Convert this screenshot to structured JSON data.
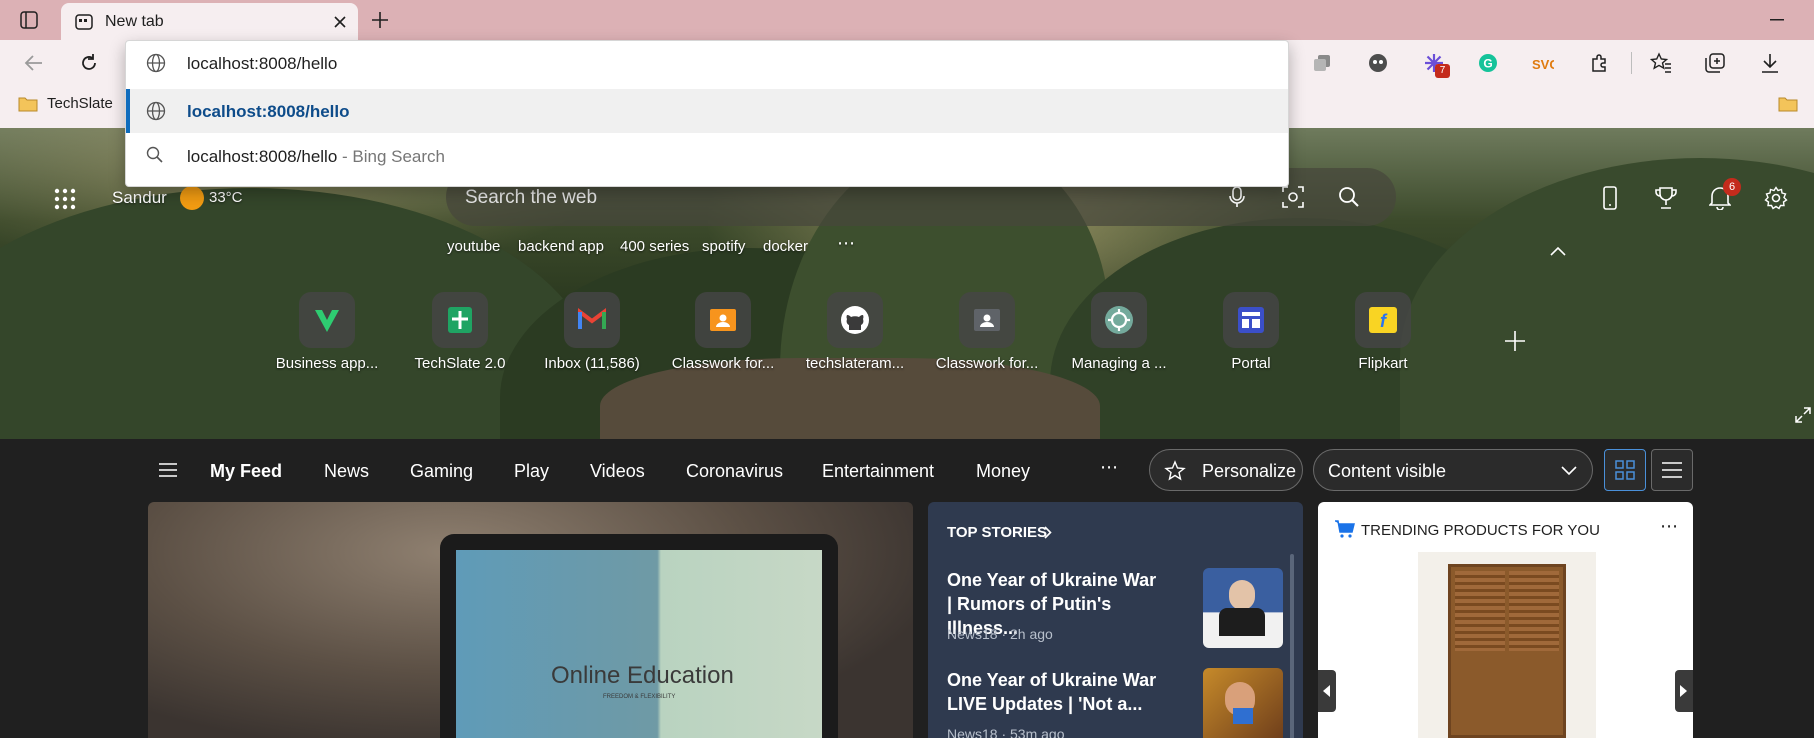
{
  "browser": {
    "tab_title": "New tab",
    "address_value": "localhost:8008/hello",
    "extension_badge": "7",
    "bookmarks": [
      "TechSlate"
    ]
  },
  "omnibox": {
    "suggestions": [
      {
        "text": "localhost:8008/hello",
        "suffix": ""
      },
      {
        "text": "localhost:8008/hello",
        "suffix": " - Bing Search"
      }
    ]
  },
  "weather": {
    "location": "Sandur",
    "temp": "33°C"
  },
  "search": {
    "placeholder": "Search the web"
  },
  "quick_links": [
    "youtube",
    "backend app",
    "400 series",
    "spotify",
    "docker"
  ],
  "more_symbol": "⋯",
  "notifications_count": "6",
  "tiles": [
    {
      "label": "Business app...",
      "icon": "vercel-like-logo-icon"
    },
    {
      "label": "TechSlate 2.0",
      "icon": "google-sheets-icon"
    },
    {
      "label": "Inbox (11,586)",
      "icon": "gmail-icon"
    },
    {
      "label": "Classwork for...",
      "icon": "google-classroom-icon"
    },
    {
      "label": "techslateram...",
      "icon": "github-icon"
    },
    {
      "label": "Classwork for...",
      "icon": "google-classroom-icon"
    },
    {
      "label": "Managing a ...",
      "icon": "chatgpt-icon"
    },
    {
      "label": "Portal",
      "icon": "portal-icon"
    },
    {
      "label": "Flipkart",
      "icon": "flipkart-icon"
    }
  ],
  "feed_nav": {
    "items": [
      "My Feed",
      "News",
      "Gaming",
      "Play",
      "Videos",
      "Coronavirus",
      "Entertainment",
      "Money"
    ],
    "personalize": "Personalize",
    "content_select": "Content visible"
  },
  "hero_card": {
    "title": "Online Education",
    "subtitle": "FREEDOM & FLEXIBILITY"
  },
  "top_stories": {
    "header": "TOP STORIES",
    "items": [
      {
        "title": "One Year of Ukraine War | Rumors of Putin's Illness...",
        "source": "News18 · 2h ago"
      },
      {
        "title": "One Year of Ukraine War LIVE Updates | 'Not a...",
        "source": "News18 · 53m ago"
      }
    ]
  },
  "trending": {
    "header": "TRENDING PRODUCTS FOR YOU"
  },
  "colors": {
    "accent": "#0f6cbd",
    "titlebar": "#dcb1b5",
    "toolbar": "#f6eef0",
    "badge": "#c42b1c"
  }
}
